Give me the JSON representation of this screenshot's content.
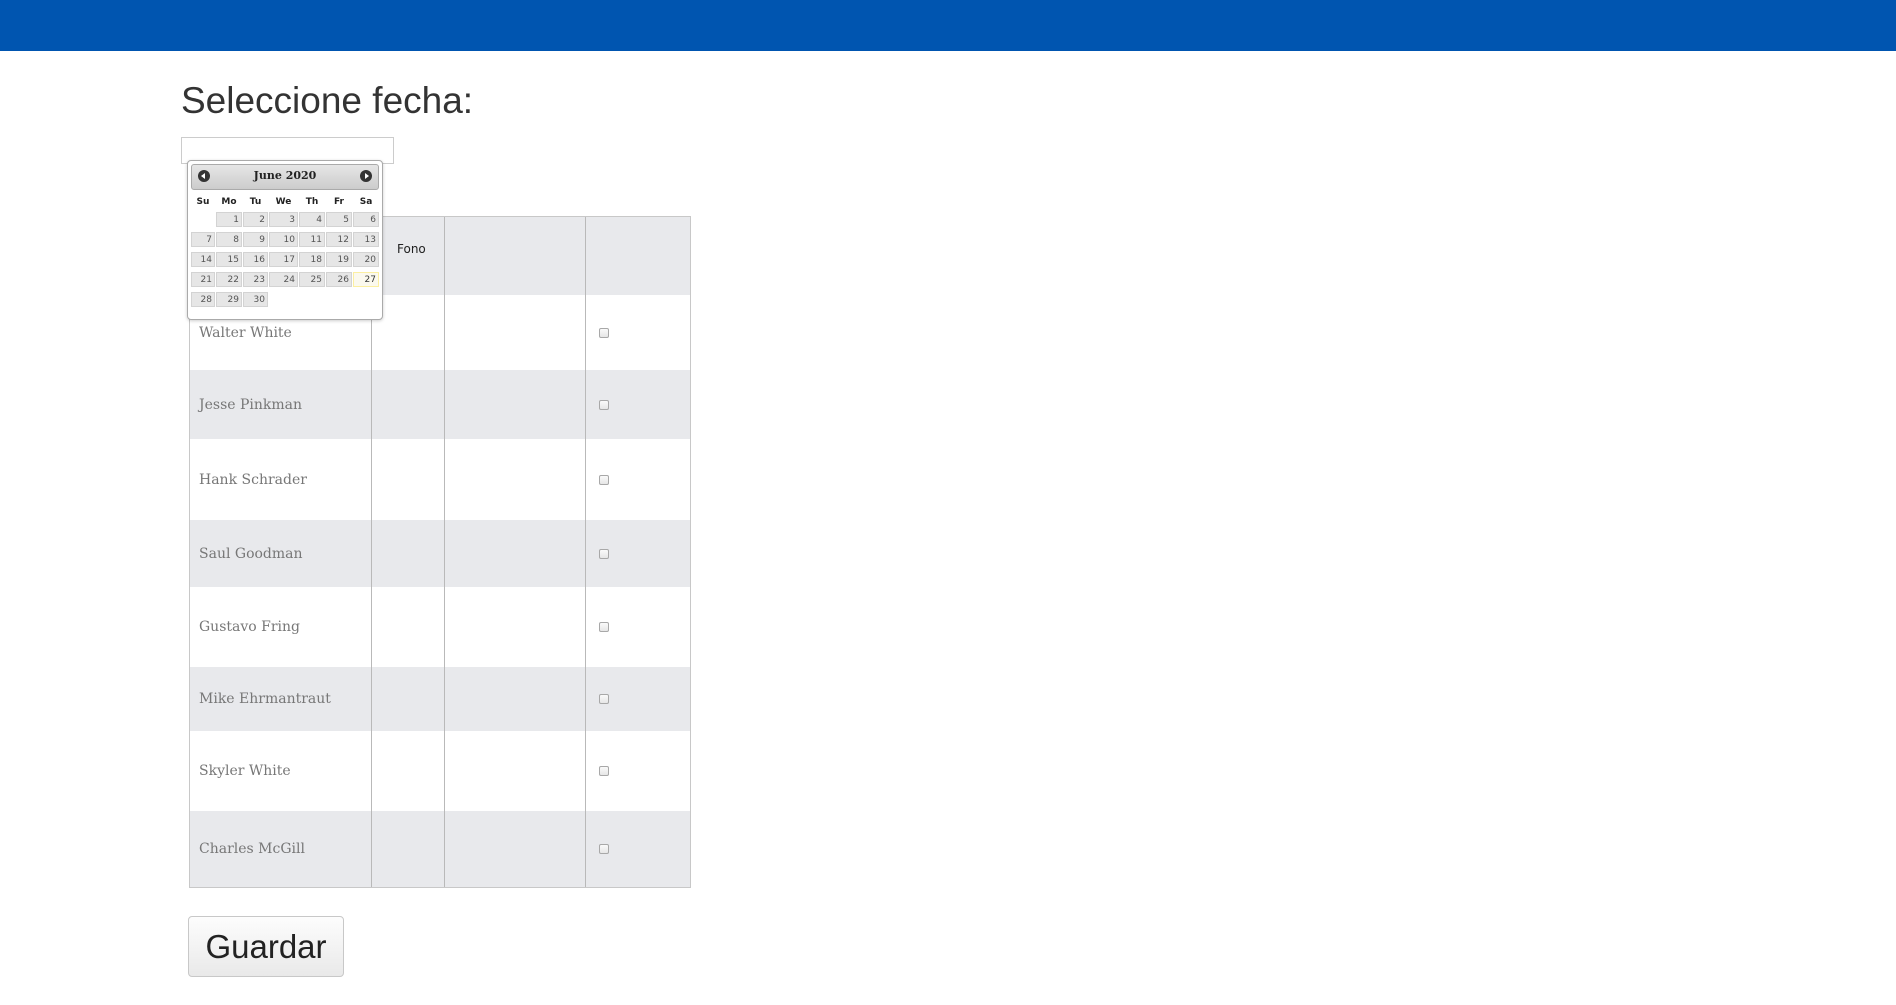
{
  "page": {
    "title": "Seleccione fecha:",
    "date_input_value": ""
  },
  "datepicker": {
    "month_label": "June 2020",
    "weekdays": [
      "Su",
      "Mo",
      "Tu",
      "We",
      "Th",
      "Fr",
      "Sa"
    ],
    "first_weekday_index": 1,
    "days": [
      "1",
      "2",
      "3",
      "4",
      "5",
      "6",
      "7",
      "8",
      "9",
      "10",
      "11",
      "12",
      "13",
      "14",
      "15",
      "16",
      "17",
      "18",
      "19",
      "20",
      "21",
      "22",
      "23",
      "24",
      "25",
      "26",
      "27",
      "28",
      "29",
      "30"
    ],
    "highlighted_day": "27"
  },
  "table": {
    "header": {
      "col2": "Fono"
    },
    "rows": [
      {
        "name": "Walter White",
        "checked": false
      },
      {
        "name": "Jesse Pinkman",
        "checked": false
      },
      {
        "name": "Hank Schrader",
        "checked": false
      },
      {
        "name": "Saul Goodman",
        "checked": false
      },
      {
        "name": "Gustavo Fring",
        "checked": false
      },
      {
        "name": "Mike Ehrmantraut",
        "checked": false
      },
      {
        "name": "Skyler White",
        "checked": false
      },
      {
        "name": "Charles McGill",
        "checked": false
      }
    ]
  },
  "actions": {
    "save_label": "Guardar"
  },
  "colors": {
    "topbar": "#0055b0",
    "row_shade": "#e8e9ec",
    "today_highlight": "#fbf9ee"
  }
}
